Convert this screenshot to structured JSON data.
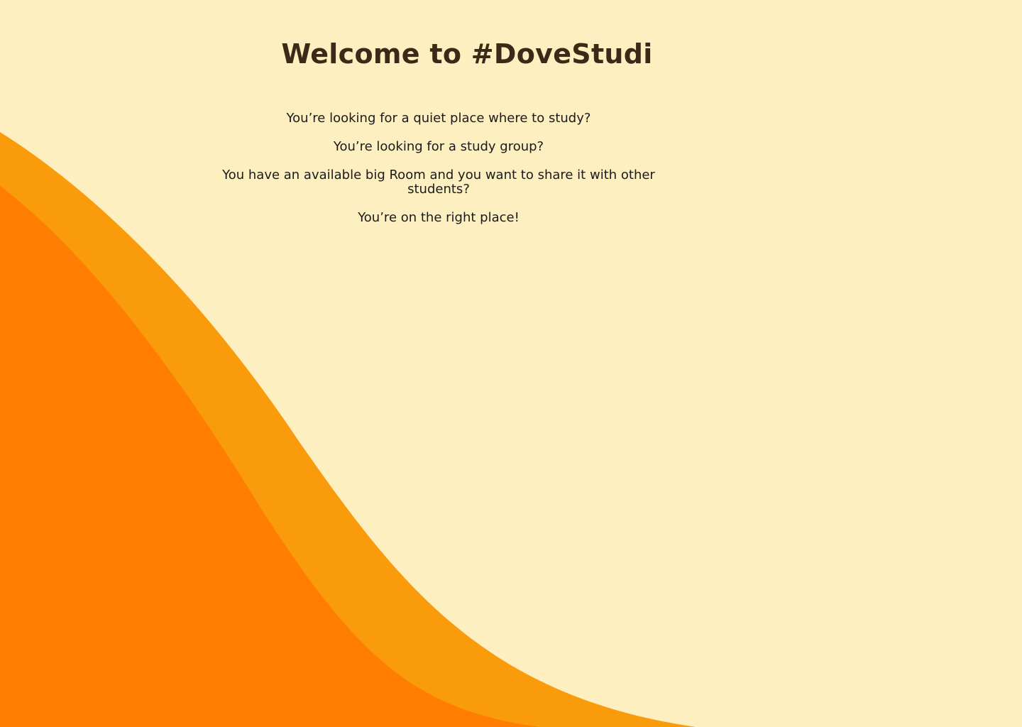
{
  "page": {
    "title": "Welcome to #DoveStudi",
    "lines": [
      "You’re looking for a quiet place where to study?",
      "You’re looking for a study group?",
      "You have an available big Room and you want to share it with other students?",
      "You’re on the right place!"
    ]
  },
  "colors": {
    "background": "#FDEFBF",
    "wave_outer": "#FA9B0C",
    "wave_inner": "#FF7D00",
    "title": "#3B2A17",
    "text": "#1A1A1A"
  }
}
